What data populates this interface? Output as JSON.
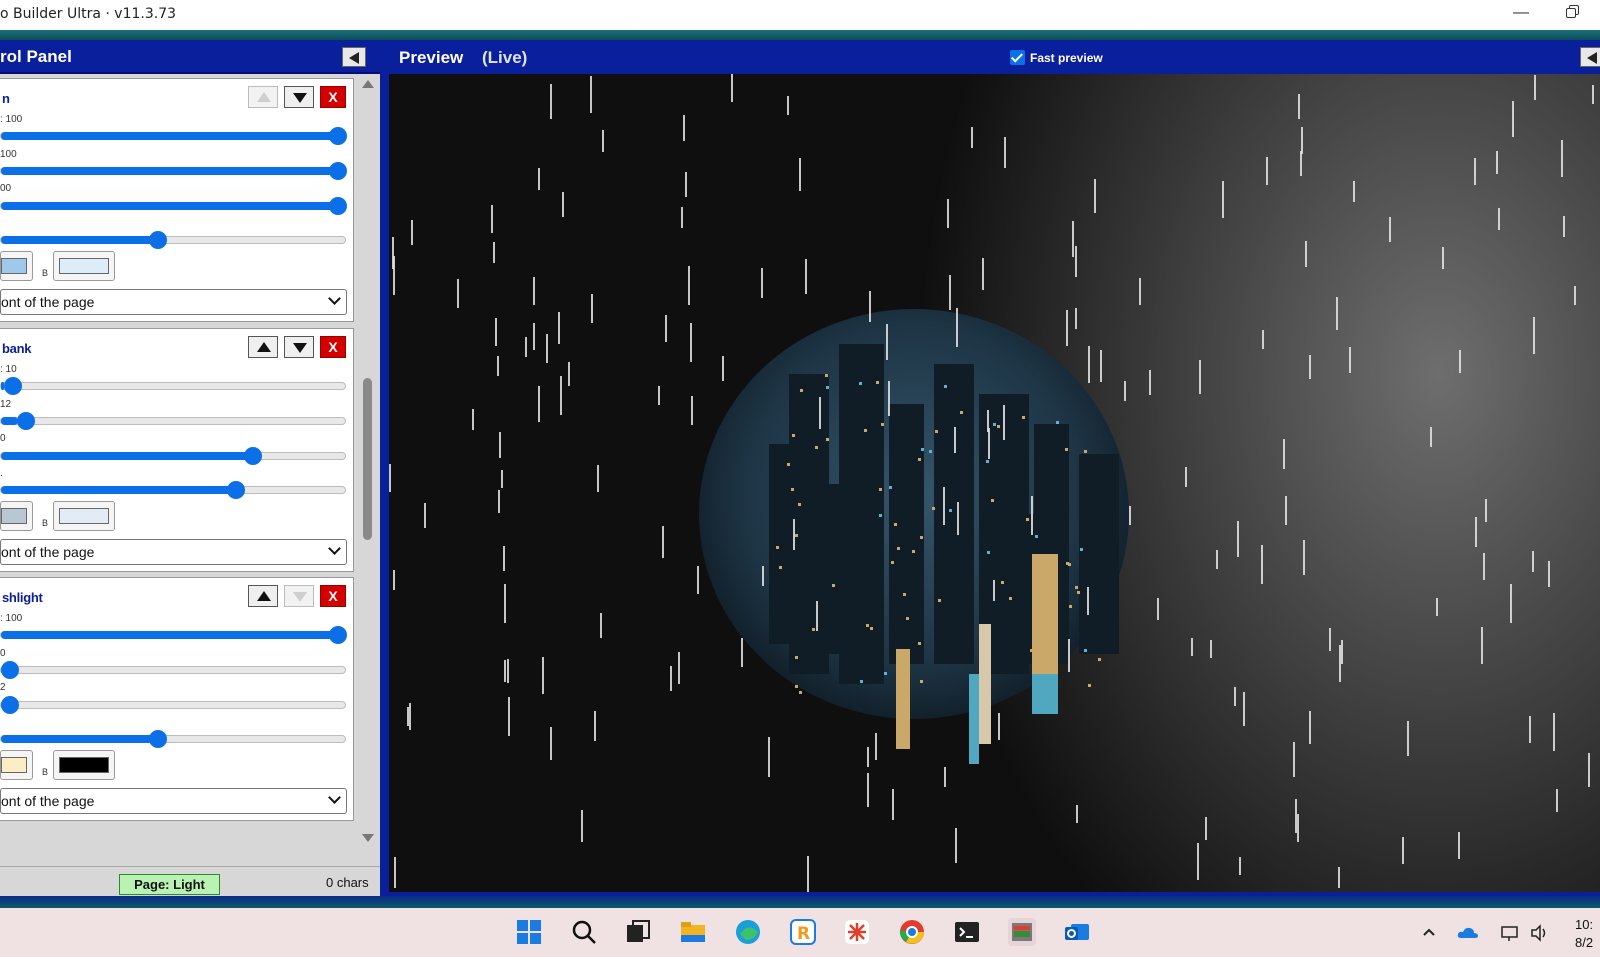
{
  "window": {
    "title": "o Builder Ultra · v11.3.73"
  },
  "control_panel": {
    "title": "rol Panel",
    "cards": [
      {
        "name": "n",
        "slider_labels": [
          ": 100",
          "100",
          "00",
          ""
        ],
        "slider_values": [
          1.0,
          1.0,
          1.0,
          0.45
        ],
        "swatch_a_color": "#9fc9ea",
        "swatch_b_label": "B",
        "swatch_b_color": "#dcedf9",
        "select_value": "ont of the page",
        "up_disabled": true,
        "down_disabled": false
      },
      {
        "name": "bank",
        "slider_labels": [
          ": 10",
          "12",
          "0",
          "."
        ],
        "slider_values": [
          0.01,
          0.05,
          0.74,
          0.69
        ],
        "swatch_a_color": "#b9c7d3",
        "swatch_b_label": "B",
        "swatch_b_color": "#e3ecf4",
        "select_value": "ont of the page",
        "up_disabled": false,
        "down_disabled": false
      },
      {
        "name": "shlight",
        "slider_labels": [
          ": 100",
          "0",
          "2",
          ""
        ],
        "slider_values": [
          1.0,
          0.0,
          0.0,
          0.45
        ],
        "swatch_a_color": "#fbeec4",
        "swatch_b_label": "B",
        "swatch_b_color": "#000000",
        "select_value": "ont of the page",
        "up_disabled": false,
        "down_disabled": true
      }
    ],
    "delete_label": "X",
    "status": {
      "page": "Page: Light",
      "chars": "0 chars"
    }
  },
  "preview": {
    "title": "Preview",
    "live_label": "(Live)",
    "fast_preview_label": "Fast preview",
    "fast_preview_checked": true
  },
  "taskbar": {
    "apps": [
      "windows-start-icon",
      "search-icon",
      "task-view-icon",
      "file-explorer-icon",
      "edge-icon",
      "r-app-icon",
      "spark-app-icon",
      "chrome-icon",
      "terminal-icon",
      "builder-app-icon",
      "outlook-icon"
    ],
    "clock_time": "10:",
    "clock_date": "8/2"
  }
}
